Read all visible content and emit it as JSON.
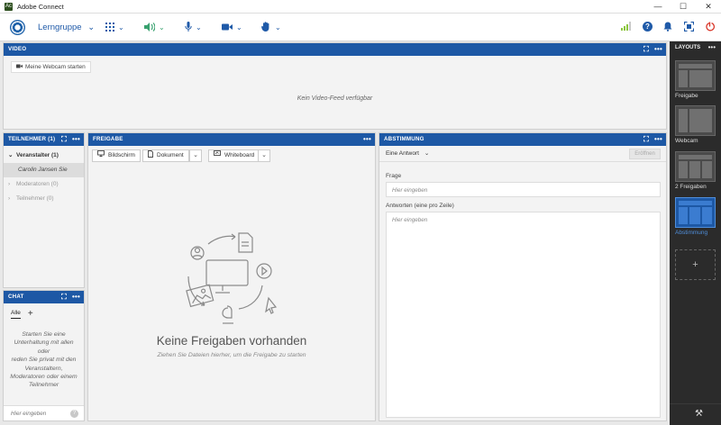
{
  "window": {
    "title": "Adobe Connect",
    "app_icon": "Ac",
    "minimize": "—",
    "maximize": "☐",
    "close": "✕"
  },
  "toolbar": {
    "room_name": "Lerngruppe",
    "chevron": "⌄",
    "apps_icon": "⋮⋮⋮",
    "speaker_icon": "🔊",
    "mic_icon": "🎤",
    "camera_icon": "▶",
    "hand_icon": "✋",
    "signal_icon": "▂▄▆",
    "help_icon": "?",
    "bell_icon": "🔔",
    "fullscreen_icon": "⛶",
    "power_icon": "⏻",
    "colors": {
      "blue": "#1f5aa8",
      "green": "#38a16f",
      "power": "#d9392c"
    }
  },
  "video": {
    "title": "VIDEO",
    "webcam_button": "Meine Webcam starten",
    "no_feed": "Kein Video-Feed verfügbar"
  },
  "participants": {
    "title": "TEILNEHMER (1)",
    "groups": [
      {
        "label": "Veranstalter (1)",
        "expanded": true
      },
      {
        "label": "Carolin Jansen Sie",
        "is_user": true
      },
      {
        "label": "Moderatoren (0)",
        "expanded": false
      },
      {
        "label": "Teilnehmer (0)",
        "expanded": false
      }
    ]
  },
  "chat": {
    "title": "CHAT",
    "tab_all": "Alle",
    "tab_add": "+",
    "empty_lines": [
      "Starten Sie eine",
      "Unterhaltung mit allen",
      "oder",
      "reden Sie privat mit den",
      "Veranstaltern,",
      "Moderatoren oder einem",
      "Teilnehmer"
    ],
    "input_placeholder": "Hier eingeben",
    "help": "?"
  },
  "share": {
    "title": "FREIGABE",
    "buttons": [
      {
        "label": "Bildschirm"
      },
      {
        "label": "Dokument"
      },
      {
        "label": "Whiteboard"
      }
    ],
    "dd": "⌄",
    "empty_title": "Keine Freigaben vorhanden",
    "empty_sub": "Ziehen Sie Dateien hierher, um die Freigabe zu starten"
  },
  "poll": {
    "title": "ABSTIMMUNG",
    "type": "Eine Antwort",
    "publish": "Eröffnen",
    "question_label": "Frage",
    "question_placeholder": "Hier eingeben",
    "answers_label": "Antworten (eine pro Zeile)",
    "answers_placeholder": "Hier eingeben"
  },
  "layouts": {
    "title": "LAYOUTS",
    "items": [
      {
        "label": "Freigabe",
        "active": false
      },
      {
        "label": "Webcam",
        "active": false
      },
      {
        "label": "2 Freigaben",
        "active": false
      },
      {
        "label": "Abstimmung",
        "active": true
      }
    ],
    "add": "+",
    "tools_icon": "⚒",
    "colors": {
      "active": "#4f8fdc"
    }
  },
  "panel_icons": {
    "expand": "⛶",
    "menu": "•••"
  },
  "header_color": "#1d58a5"
}
